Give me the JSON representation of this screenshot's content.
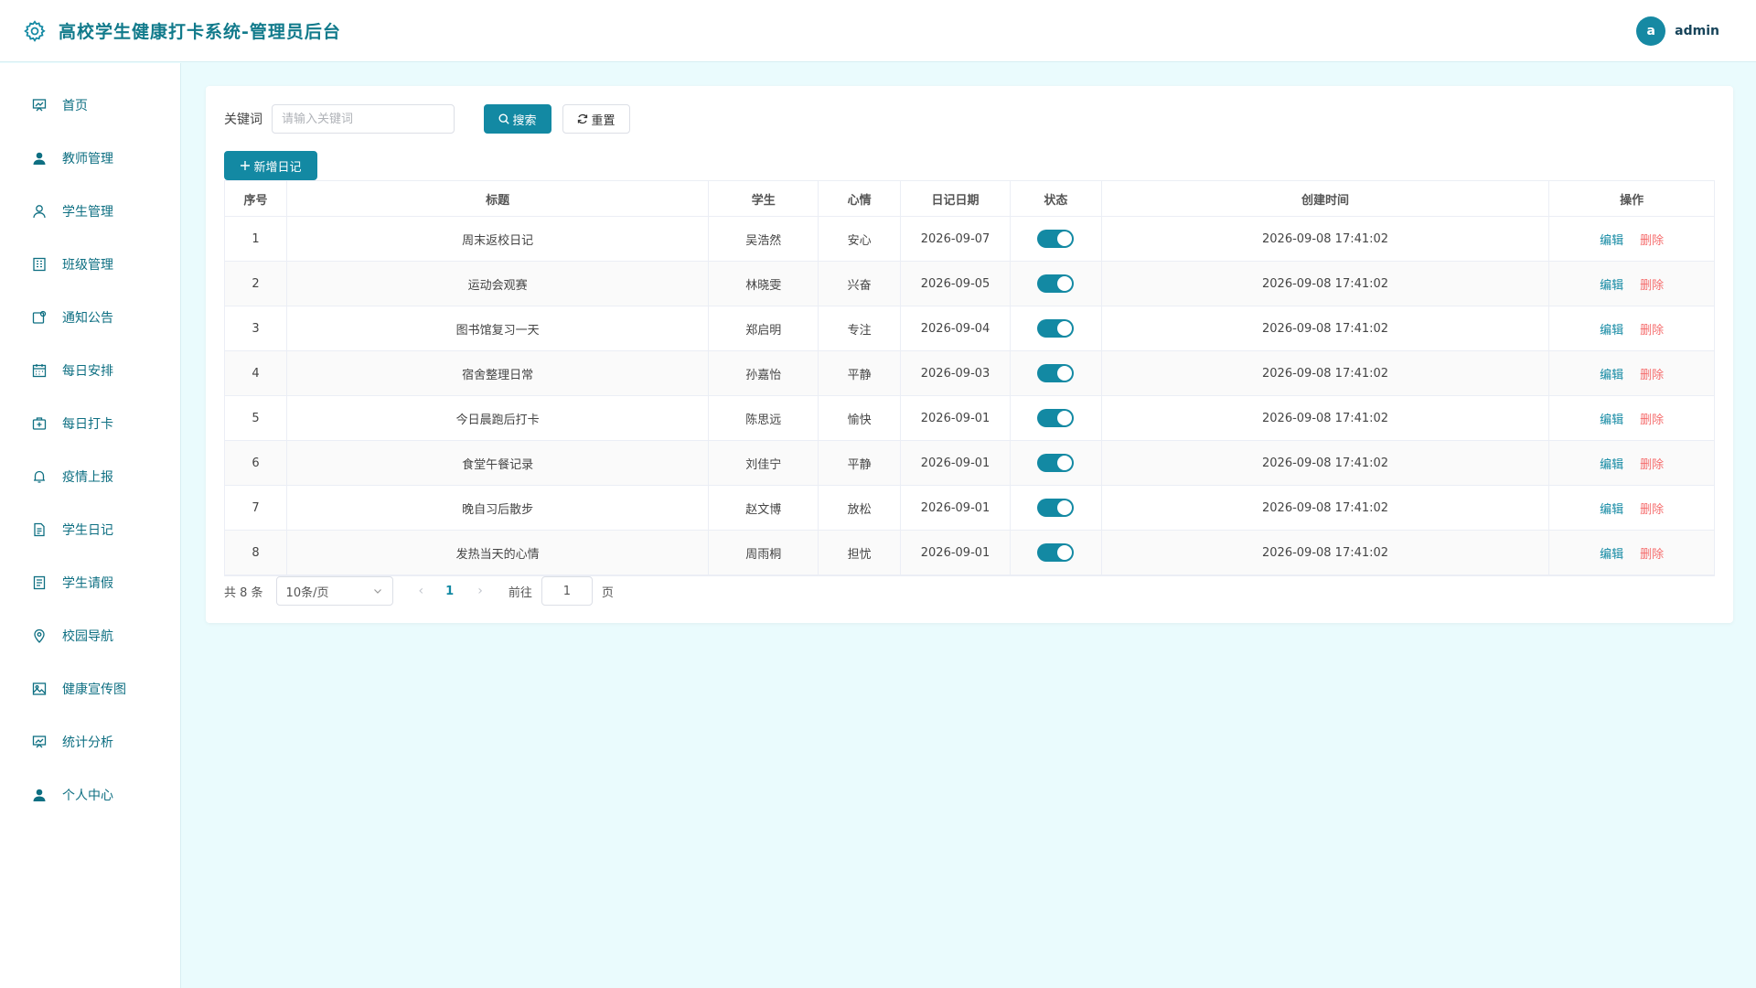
{
  "header": {
    "title": "高校学生健康打卡系统-管理员后台",
    "avatar_letter": "a",
    "username": "admin"
  },
  "sidebar": {
    "items": [
      {
        "label": "首页",
        "icon": "dashboard-icon"
      },
      {
        "label": "教师管理",
        "icon": "user-solid-icon"
      },
      {
        "label": "学生管理",
        "icon": "user-icon"
      },
      {
        "label": "班级管理",
        "icon": "building-icon"
      },
      {
        "label": "通知公告",
        "icon": "notice-icon"
      },
      {
        "label": "每日安排",
        "icon": "calendar-icon"
      },
      {
        "label": "每日打卡",
        "icon": "first-aid-icon"
      },
      {
        "label": "疫情上报",
        "icon": "bell-icon"
      },
      {
        "label": "学生日记",
        "icon": "document-icon"
      },
      {
        "label": "学生请假",
        "icon": "tickets-icon"
      },
      {
        "label": "校园导航",
        "icon": "location-icon"
      },
      {
        "label": "健康宣传图",
        "icon": "picture-icon"
      },
      {
        "label": "统计分析",
        "icon": "chart-board-icon"
      },
      {
        "label": "个人中心",
        "icon": "user-solid-icon"
      }
    ]
  },
  "filter": {
    "keyword_label": "关键词",
    "keyword_placeholder": "请输入关键词",
    "keyword_value": "",
    "search_label": "搜索",
    "reset_label": "重置"
  },
  "add_button_label": "新增日记",
  "table": {
    "columns": [
      "序号",
      "标题",
      "学生",
      "心情",
      "日记日期",
      "状态",
      "创建时间",
      "操作"
    ],
    "rows": [
      {
        "no": "1",
        "title": "周末返校日记",
        "student": "吴浩然",
        "mood": "安心",
        "date": "2026-09-07",
        "status": true,
        "created": "2026-09-08 17:41:02"
      },
      {
        "no": "2",
        "title": "运动会观赛",
        "student": "林晓雯",
        "mood": "兴奋",
        "date": "2026-09-05",
        "status": true,
        "created": "2026-09-08 17:41:02"
      },
      {
        "no": "3",
        "title": "图书馆复习一天",
        "student": "郑启明",
        "mood": "专注",
        "date": "2026-09-04",
        "status": true,
        "created": "2026-09-08 17:41:02"
      },
      {
        "no": "4",
        "title": "宿舍整理日常",
        "student": "孙嘉怡",
        "mood": "平静",
        "date": "2026-09-03",
        "status": true,
        "created": "2026-09-08 17:41:02"
      },
      {
        "no": "5",
        "title": "今日晨跑后打卡",
        "student": "陈思远",
        "mood": "愉快",
        "date": "2026-09-01",
        "status": true,
        "created": "2026-09-08 17:41:02"
      },
      {
        "no": "6",
        "title": "食堂午餐记录",
        "student": "刘佳宁",
        "mood": "平静",
        "date": "2026-09-01",
        "status": true,
        "created": "2026-09-08 17:41:02"
      },
      {
        "no": "7",
        "title": "晚自习后散步",
        "student": "赵文博",
        "mood": "放松",
        "date": "2026-09-01",
        "status": true,
        "created": "2026-09-08 17:41:02"
      },
      {
        "no": "8",
        "title": "发热当天的心情",
        "student": "周雨桐",
        "mood": "担忧",
        "date": "2026-09-01",
        "status": true,
        "created": "2026-09-08 17:41:02"
      }
    ],
    "edit_label": "编辑",
    "delete_label": "删除"
  },
  "pagination": {
    "total_text": "共 8 条",
    "page_size": "10条/页",
    "current_page": "1",
    "goto_label": "前往",
    "goto_value": "1",
    "goto_suffix": "页"
  },
  "colors": {
    "accent": "#1389a3",
    "danger": "#f56c6c",
    "background": "#eafbfd"
  }
}
